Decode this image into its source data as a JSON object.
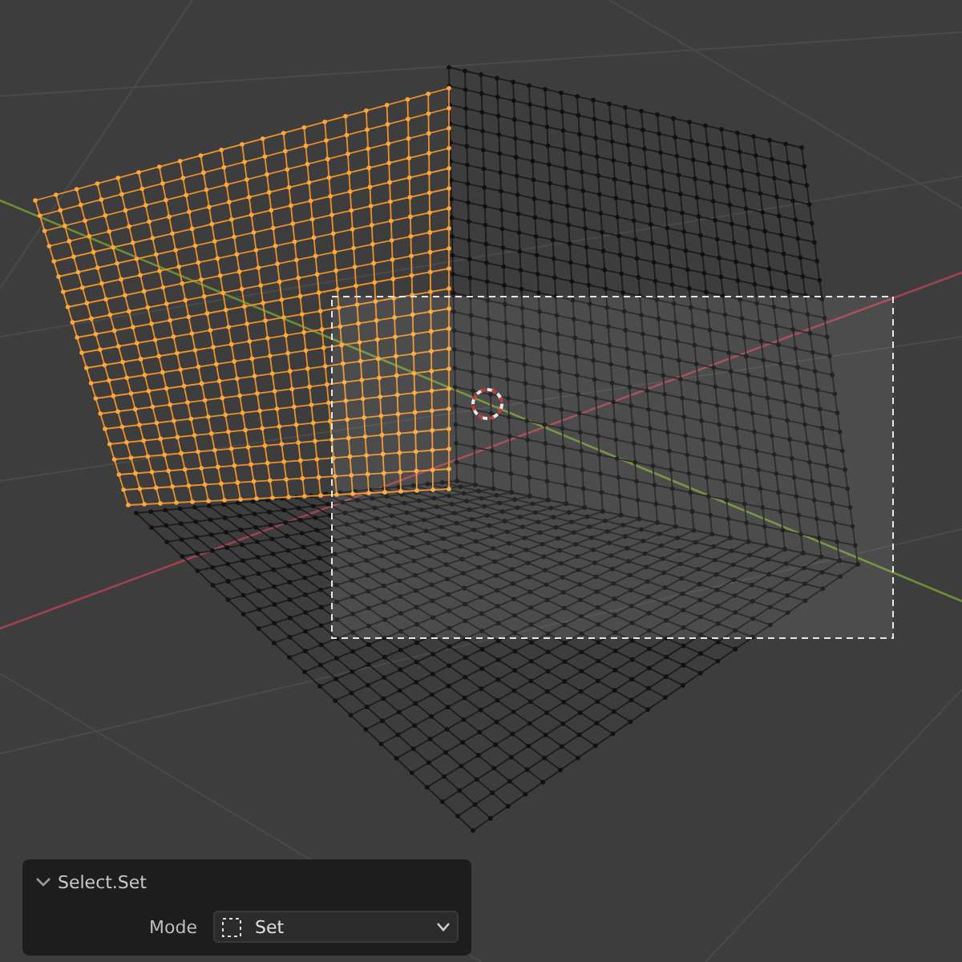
{
  "operator_panel": {
    "title": "Select.Set",
    "expanded": true,
    "fields": [
      {
        "label": "Mode",
        "value": "Set"
      }
    ]
  }
}
